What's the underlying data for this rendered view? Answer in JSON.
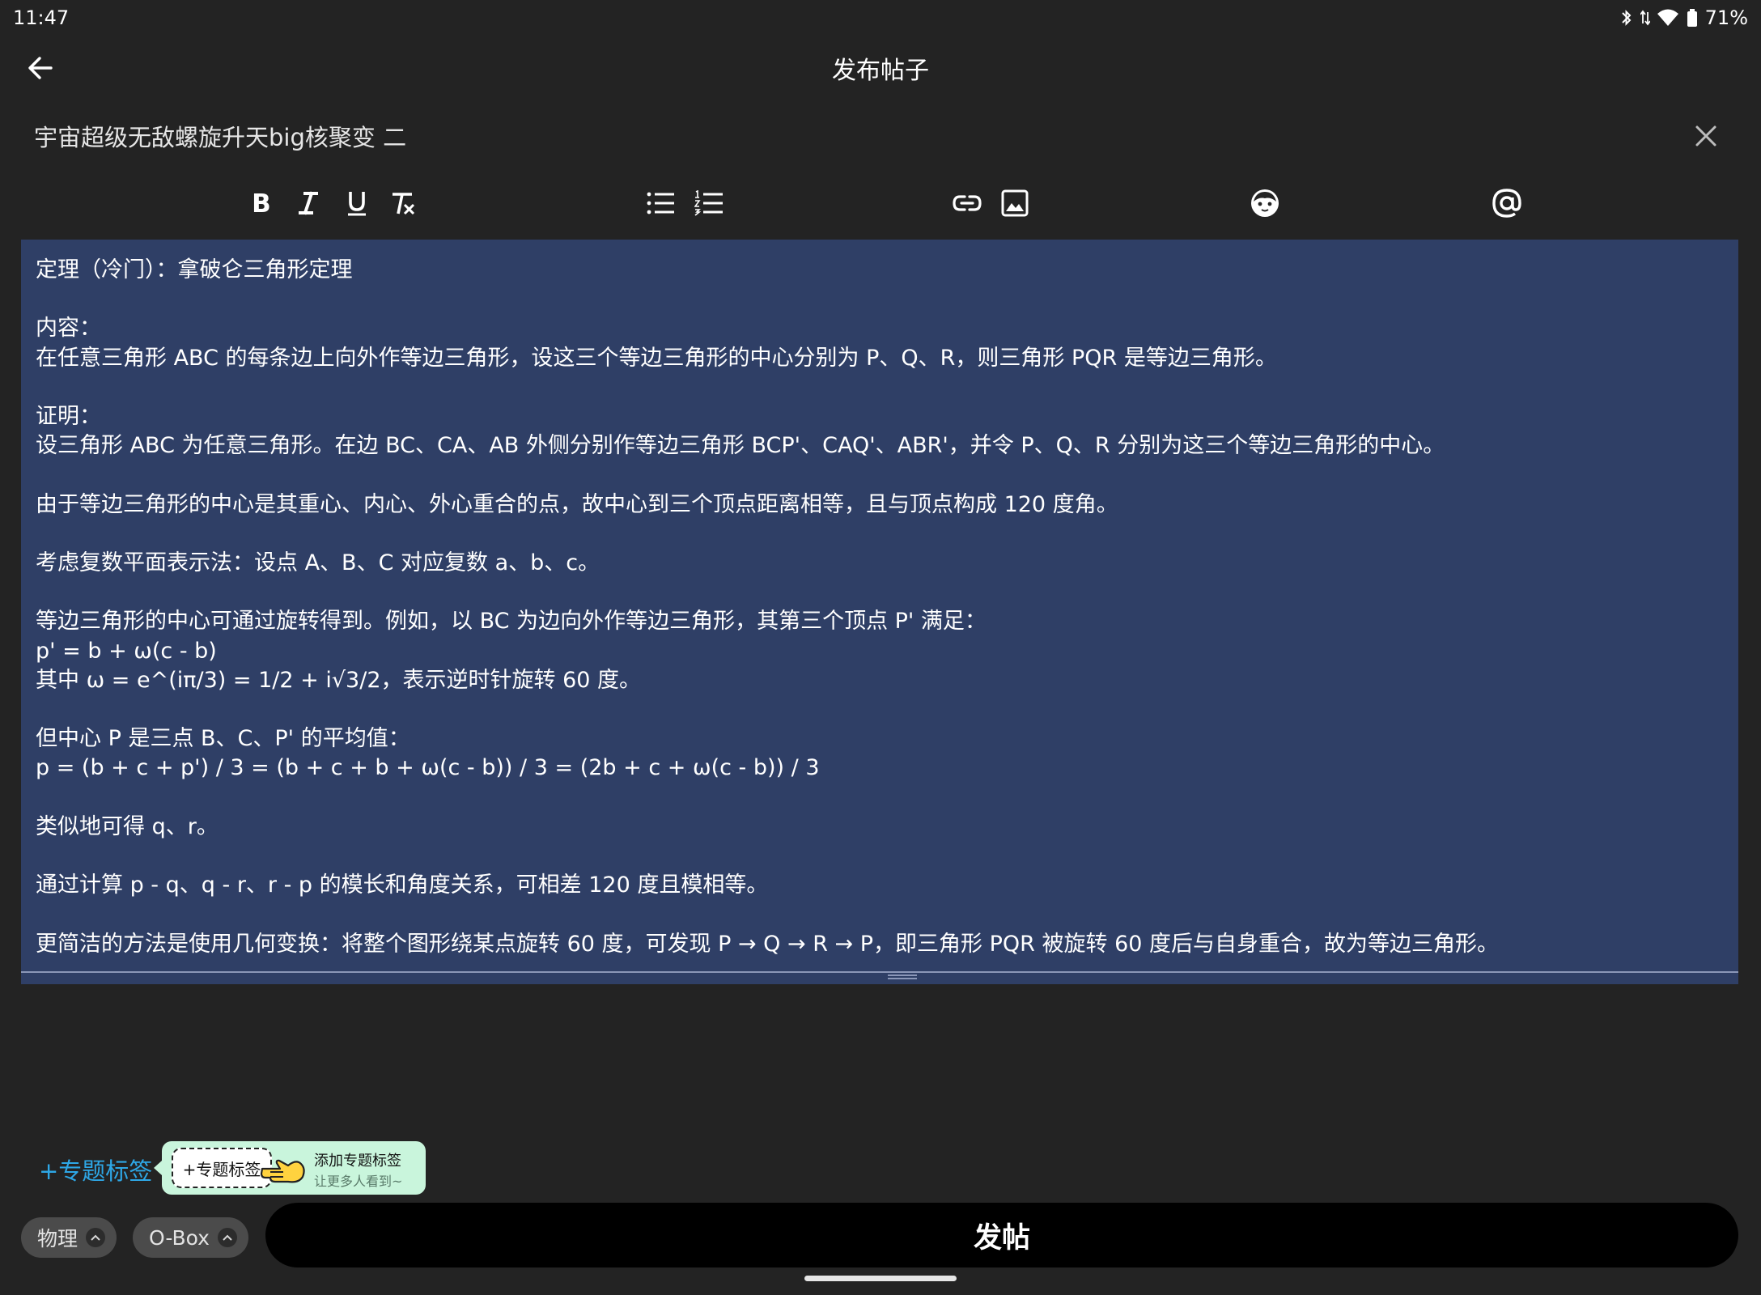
{
  "status_bar": {
    "time": "11:47",
    "battery": "71%"
  },
  "header": {
    "title": "发布帖子"
  },
  "post": {
    "title": "宇宙超级无敌螺旋升天big核聚变 二"
  },
  "editor": {
    "lines": [
      "定理（冷门）：拿破仑三角形定理",
      "",
      "内容：",
      "在任意三角形 ABC 的每条边上向外作等边三角形，设这三个等边三角形的中心分别为 P、Q、R，则三角形 PQR 是等边三角形。",
      "",
      "证明：",
      "设三角形 ABC 为任意三角形。在边 BC、CA、AB 外侧分别作等边三角形 BCP'、CAQ'、ABR'，并令 P、Q、R 分别为这三个等边三角形的中心。",
      "",
      "由于等边三角形的中心是其重心、内心、外心重合的点，故中心到三个顶点距离相等，且与顶点构成 120 度角。",
      "",
      "考虑复数平面表示法：设点 A、B、C 对应复数 a、b、c。",
      "",
      "等边三角形的中心可通过旋转得到。例如，以 BC 为边向外作等边三角形，其第三个顶点 P' 满足：",
      "p' = b + ω(c - b)",
      "其中 ω = e^(iπ/3) = 1/2 + i√3/2，表示逆时针旋转 60 度。",
      "",
      "但中心 P 是三点 B、C、P' 的平均值：",
      "p = (b + c + p') / 3 = (b + c + b + ω(c - b)) / 3 = (2b + c + ω(c - b)) / 3",
      "",
      "类似地可得 q、r。",
      "",
      "通过计算 p - q、q - r、r - p 的模长和角度关系，可相差 120 度且模相等。",
      "",
      "更简洁的方法是使用几何变换：将整个图形绕某点旋转 60 度，可发现 P → Q → R → P，即三角形 PQR 被旋转 60 度后与自身重合，故为等边三角形。"
    ]
  },
  "topic": {
    "link_label": "+专题标签",
    "tooltip_chip": "+专题标签",
    "tooltip_title": "添加专题标签",
    "tooltip_subtitle": "让更多人看到~"
  },
  "chips": [
    {
      "label": "物理"
    },
    {
      "label": "O-Box"
    }
  ],
  "submit": {
    "label": "发帖"
  },
  "colors": {
    "background": "#232323",
    "editor_bg": "#2f3f66",
    "accent_link": "#2ea7e6",
    "tooltip_bg": "#c9f5dc",
    "chip_bg": "#4b4b4b",
    "submit_bg": "#000000"
  },
  "icons": {
    "toolbar": [
      "bold-icon",
      "italic-icon",
      "underline-icon",
      "clear-format-icon",
      "bullet-list-icon",
      "numbered-list-icon",
      "link-icon",
      "image-icon",
      "emoji-icon",
      "mention-icon"
    ]
  }
}
